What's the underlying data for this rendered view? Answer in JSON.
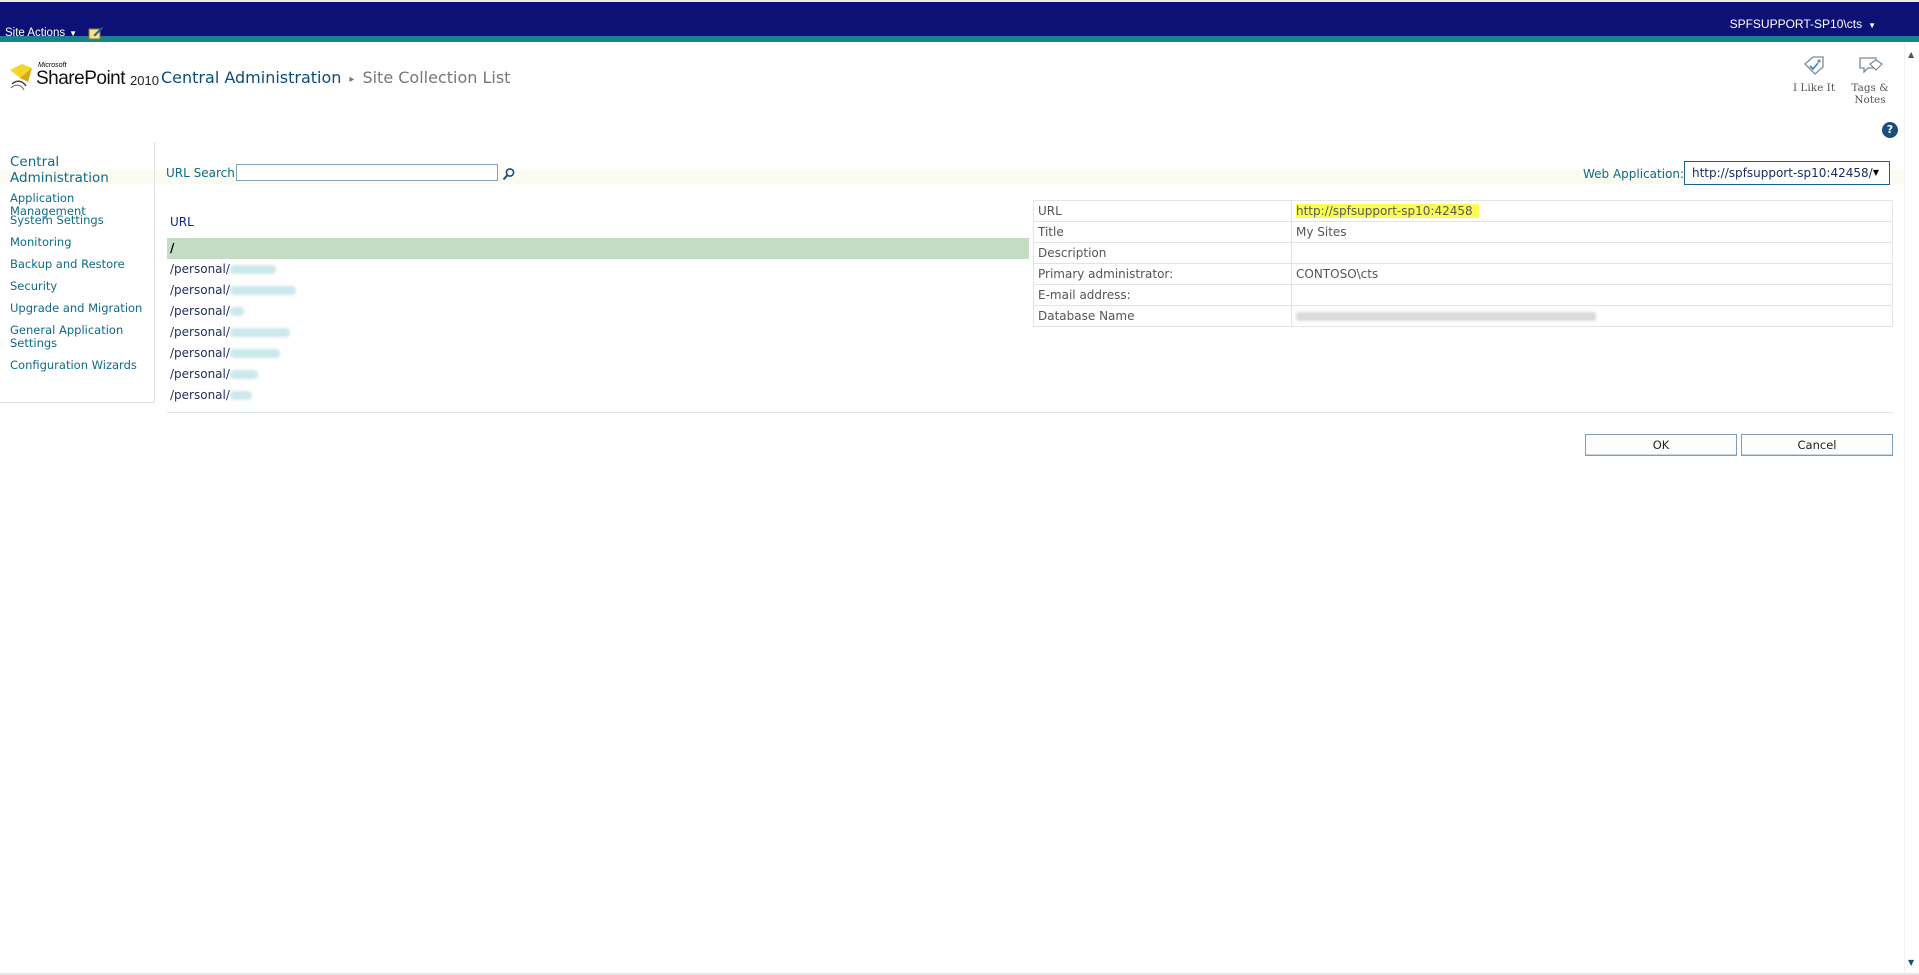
{
  "top_bar": {
    "site_actions": "Site Actions",
    "user": "SPFSUPPORT-SP10\\cts"
  },
  "logo": {
    "microsoft": "Microsoft",
    "sharepoint": "SharePoint",
    "year": "2010"
  },
  "breadcrumb": {
    "root": "Central Administration",
    "current": "Site Collection List"
  },
  "social": {
    "like": "I Like It",
    "tags_line1": "Tags &",
    "tags_line2": "Notes"
  },
  "help": "?",
  "leftnav": {
    "head_line1": "Central",
    "head_line2": "Administration",
    "items": [
      "Application Management",
      "System Settings",
      "Monitoring",
      "Backup and Restore",
      "Security",
      "Upgrade and Migration",
      "General Application",
      "Settings",
      "Configuration Wizards"
    ]
  },
  "search": {
    "label": "URL Search",
    "value": ""
  },
  "web_application": {
    "label": "Web Application:",
    "value": "http://spfsupport-sp10:42458/"
  },
  "url_list": {
    "header": "URL",
    "items": [
      "/",
      "/personal/",
      "/personal/",
      "/personal/",
      "/personal/",
      "/personal/",
      "/personal/",
      "/personal/"
    ]
  },
  "properties": {
    "url_label": "URL",
    "url_value": "http://spfsupport-sp10:42458",
    "title_label": "Title",
    "title_value": "My Sites",
    "description_label": "Description",
    "description_value": "",
    "admin_label": "Primary administrator:",
    "admin_value": "CONTOSO\\cts",
    "email_label": "E-mail address:",
    "email_value": "",
    "db_label": "Database Name"
  },
  "buttons": {
    "ok": "OK",
    "cancel": "Cancel"
  },
  "colors": {
    "topbar": "#0d1175",
    "teal": "#1b7f8c",
    "link": "#0e6b89",
    "selected_row": "#c4dcc4",
    "highlight": "#fbfb55"
  }
}
